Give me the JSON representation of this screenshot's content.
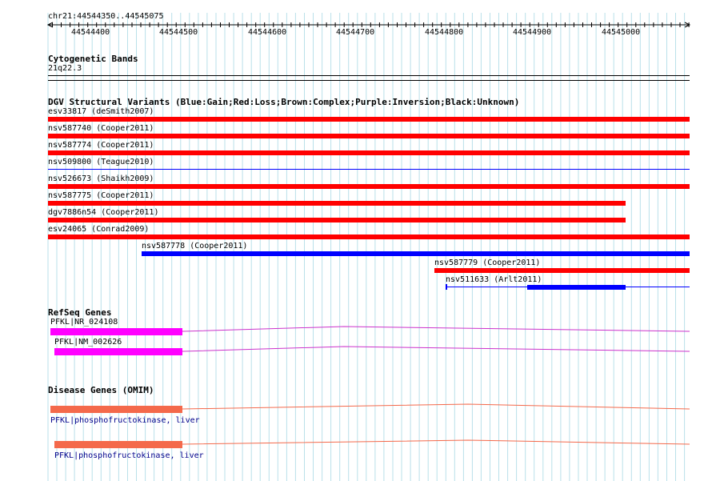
{
  "window": {
    "title": ""
  },
  "ruler": {
    "range_label": "chr21:44544350..44545075",
    "ticks": [
      "44544400",
      "44544500",
      "44544600",
      "44544700",
      "44544800",
      "44544900",
      "44545000"
    ]
  },
  "cytoband": {
    "title": "Cytogenetic Bands",
    "band": "21q22.3"
  },
  "dgv": {
    "title": "DGV Structural Variants (Blue:Gain;Red:Loss;Brown:Complex;Purple:Inversion;Black:Unknown)",
    "colors": {
      "gain": "#0000ff",
      "loss": "#ff0000"
    },
    "items": [
      {
        "label": "esv33817 (deSmith2007)",
        "type": "loss"
      },
      {
        "label": "nsv587740 (Cooper2011)",
        "type": "loss"
      },
      {
        "label": "nsv587774 (Cooper2011)",
        "type": "loss"
      },
      {
        "label": "nsv509800 (Teague2010)",
        "type": "gain"
      },
      {
        "label": "nsv526673 (Shaikh2009)",
        "type": "loss"
      },
      {
        "label": "nsv587775 (Cooper2011)",
        "type": "loss"
      },
      {
        "label": "dgv7886n54 (Cooper2011)",
        "type": "loss"
      },
      {
        "label": "esv24065 (Conrad2009)",
        "type": "loss"
      },
      {
        "label": "nsv587778 (Cooper2011)",
        "type": "gain"
      },
      {
        "label": "nsv587779 (Cooper2011)",
        "type": "loss"
      },
      {
        "label": "nsv511633 (Arlt2011)",
        "type": "gain"
      }
    ]
  },
  "refseq": {
    "title": "RefSeq Genes",
    "color": "#ff00ff",
    "items": [
      {
        "label": "PFKL|NR_024108"
      },
      {
        "label": "PFKL|NM_002626"
      }
    ]
  },
  "omim": {
    "title": "Disease Genes (OMIM)",
    "color": "#f4694b",
    "items": [
      {
        "label": "PFKL|phosphofructokinase, liver"
      },
      {
        "label": "PFKL|phosphofructokinase, liver"
      }
    ]
  }
}
